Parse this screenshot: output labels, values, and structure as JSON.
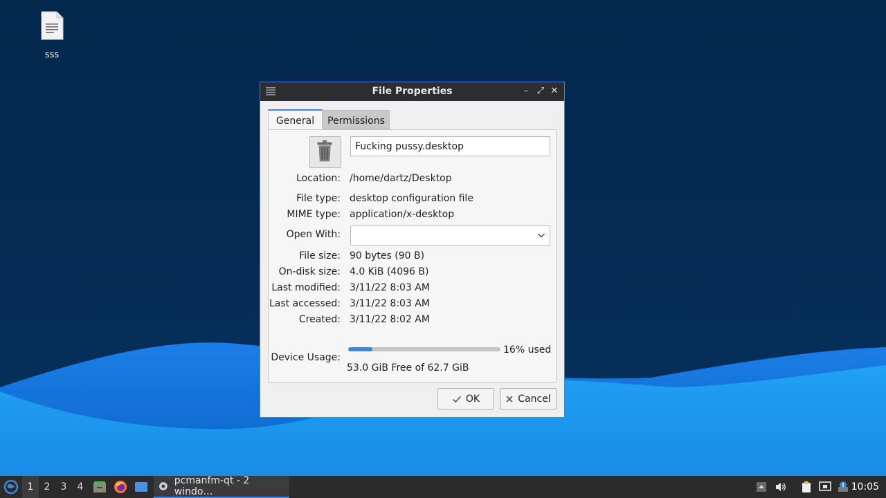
{
  "desktop": {
    "icon_label": "sss"
  },
  "window": {
    "title": "File Properties",
    "controls": {
      "minimize": "–",
      "maximize": "⤢",
      "close": "✕"
    }
  },
  "tabs": [
    {
      "label": "General",
      "active": true
    },
    {
      "label": "Permissions",
      "active": false
    }
  ],
  "general": {
    "filename": "Fucking pussy.desktop",
    "location_label": "Location:",
    "location": "/home/dartz/Desktop",
    "file_type_label": "File type:",
    "file_type": "desktop configuration file",
    "mime_type_label": "MIME type:",
    "mime_type": "application/x-desktop",
    "open_with_label": "Open With:",
    "open_with_value": "",
    "file_size_label": "File size:",
    "file_size": "90 bytes (90 B)",
    "on_disk_size_label": "On-disk size:",
    "on_disk_size": "4.0 KiB (4096 B)",
    "last_modified_label": "Last modified:",
    "last_modified": "3/11/22 8:03 AM",
    "last_accessed_label": "Last accessed:",
    "last_accessed": "3/11/22 8:03 AM",
    "created_label": "Created:",
    "created": "3/11/22 8:02 AM",
    "device_usage_label": "Device Usage:",
    "device_usage_percent": 16,
    "device_usage_text": "16% used",
    "device_free_text": "53.0 GiB Free of 62.7 GiB"
  },
  "buttons": {
    "ok": "OK",
    "cancel": "Cancel"
  },
  "taskbar": {
    "desktops": [
      "1",
      "2",
      "3",
      "4"
    ],
    "active_desktop": "1",
    "task_label": "pcmanfm-qt - 2 windo…",
    "clock": "10:05"
  },
  "colors": {
    "accent": "#3b86d8",
    "titlebar": "#2d2d31",
    "taskbar": "#2b2b2b"
  }
}
